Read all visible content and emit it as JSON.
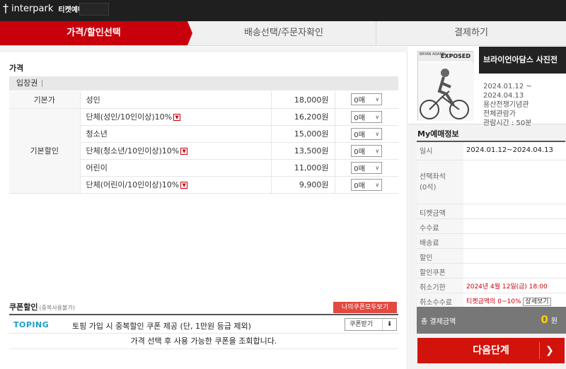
{
  "header": {
    "brand": "interpark",
    "service": "티켓예매"
  },
  "steps": [
    {
      "label": "가격/할인선택"
    },
    {
      "label": "배송선택/주문자확인"
    },
    {
      "label": "결제하기"
    }
  ],
  "price_section": {
    "title": "가격",
    "ticket_type": "입장권",
    "rows": [
      {
        "category": "기본가",
        "name": "성인",
        "price": "18,000원",
        "qty": "0매"
      },
      {
        "category": "기본할인",
        "name": "단체(성인/10인이상)10%",
        "price": "16,200원",
        "qty": "0매"
      },
      {
        "category": "",
        "name": "청소년",
        "price": "15,000원",
        "qty": "0매"
      },
      {
        "category": "",
        "name": "단체(청소년/10인이상)10%",
        "price": "13,500원",
        "qty": "0매"
      },
      {
        "category": "",
        "name": "어린이",
        "price": "11,000원",
        "qty": "0매"
      },
      {
        "category": "",
        "name": "단체(어린이/10인이상)10%",
        "price": "9,900원",
        "qty": "0매"
      }
    ]
  },
  "coupon": {
    "title": "쿠폰할인",
    "note": "(중복사용불가)",
    "my_coupons_button": "나의쿠폰모두보기",
    "toping_logo": "TOPING",
    "toping_text": "토핑 가입 시 중복할인 쿠폰 제공 (단, 1만원 등급 제외)",
    "toping_button": "쿠폰받기",
    "message": "가격 선택 후 사용 가능한 쿠폰을 조회합니다."
  },
  "show": {
    "title": "브라이언아담스 사진전",
    "poster_text": "EXPOSED",
    "poster_subtitle": "BRYAN ADAMS",
    "dates": [
      "2024.01.12 ~",
      "2024.04.13"
    ],
    "venue": "용산전쟁기념관",
    "rating": "전체관람가",
    "runtime": "관람시간 : 50분"
  },
  "my_booking": {
    "title": "My예매정보",
    "rows": [
      {
        "label": "일시",
        "value": "2024.01.12~2024.04.13"
      },
      {
        "label": "선택좌석\n(0석)",
        "value": ""
      },
      {
        "label": "티켓금액",
        "value": ""
      },
      {
        "label": "수수료",
        "value": ""
      },
      {
        "label": "배송료",
        "value": ""
      },
      {
        "label": "할인",
        "value": ""
      },
      {
        "label": "할인쿠폰",
        "value": ""
      },
      {
        "label": "취소기한",
        "value": "2024년 4월 12일(금) 18:00"
      },
      {
        "label": "취소수수료",
        "value": "티켓금액의 0~10%",
        "button": "상세보기"
      }
    ],
    "total_label": "총 결제금액",
    "total_value": "0",
    "total_unit": "원"
  },
  "next_button": "다음단계",
  "colors": {
    "brand_red": "#c8000c",
    "next_red": "#d1130b",
    "total_yellow": "#ffcc00"
  }
}
